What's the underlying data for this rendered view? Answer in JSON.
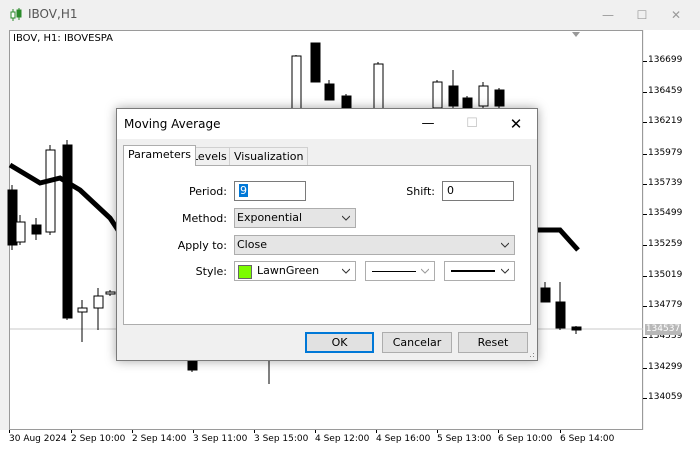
{
  "window": {
    "title": "IBOV,H1",
    "icon": "candlestick-chart-icon"
  },
  "chart": {
    "symbol_label": "IBOV, H1:  IBOVESPA",
    "current_price": "134537",
    "price_labels": [
      "136699",
      "136459",
      "136219",
      "135979",
      "135739",
      "135499",
      "135259",
      "135019",
      "134779",
      "134539",
      "134299",
      "134059"
    ],
    "time_labels": [
      "30 Aug 2024",
      "2 Sep 10:00",
      "2 Sep 14:00",
      "3 Sep 11:00",
      "3 Sep 15:00",
      "4 Sep 12:00",
      "4 Sep 16:00",
      "5 Sep 13:00",
      "6 Sep 10:00",
      "6 Sep 14:00"
    ],
    "ma_color": "#000000"
  },
  "dialog": {
    "title": "Moving Average",
    "tabs": [
      {
        "label": "Parameters"
      },
      {
        "label": "Levels"
      },
      {
        "label": "Visualization"
      }
    ],
    "active_tab": "Parameters",
    "period_label": "Period:",
    "period_value": "9",
    "shift_label": "Shift:",
    "shift_value": "0",
    "method_label": "Method:",
    "method_value": "Exponential",
    "apply_label": "Apply to:",
    "apply_value": "Close",
    "style_label": "Style:",
    "color_name": "LawnGreen",
    "color_hex": "#7cfc00",
    "buttons": {
      "ok": "OK",
      "cancel": "Cancelar",
      "reset": "Reset"
    }
  }
}
